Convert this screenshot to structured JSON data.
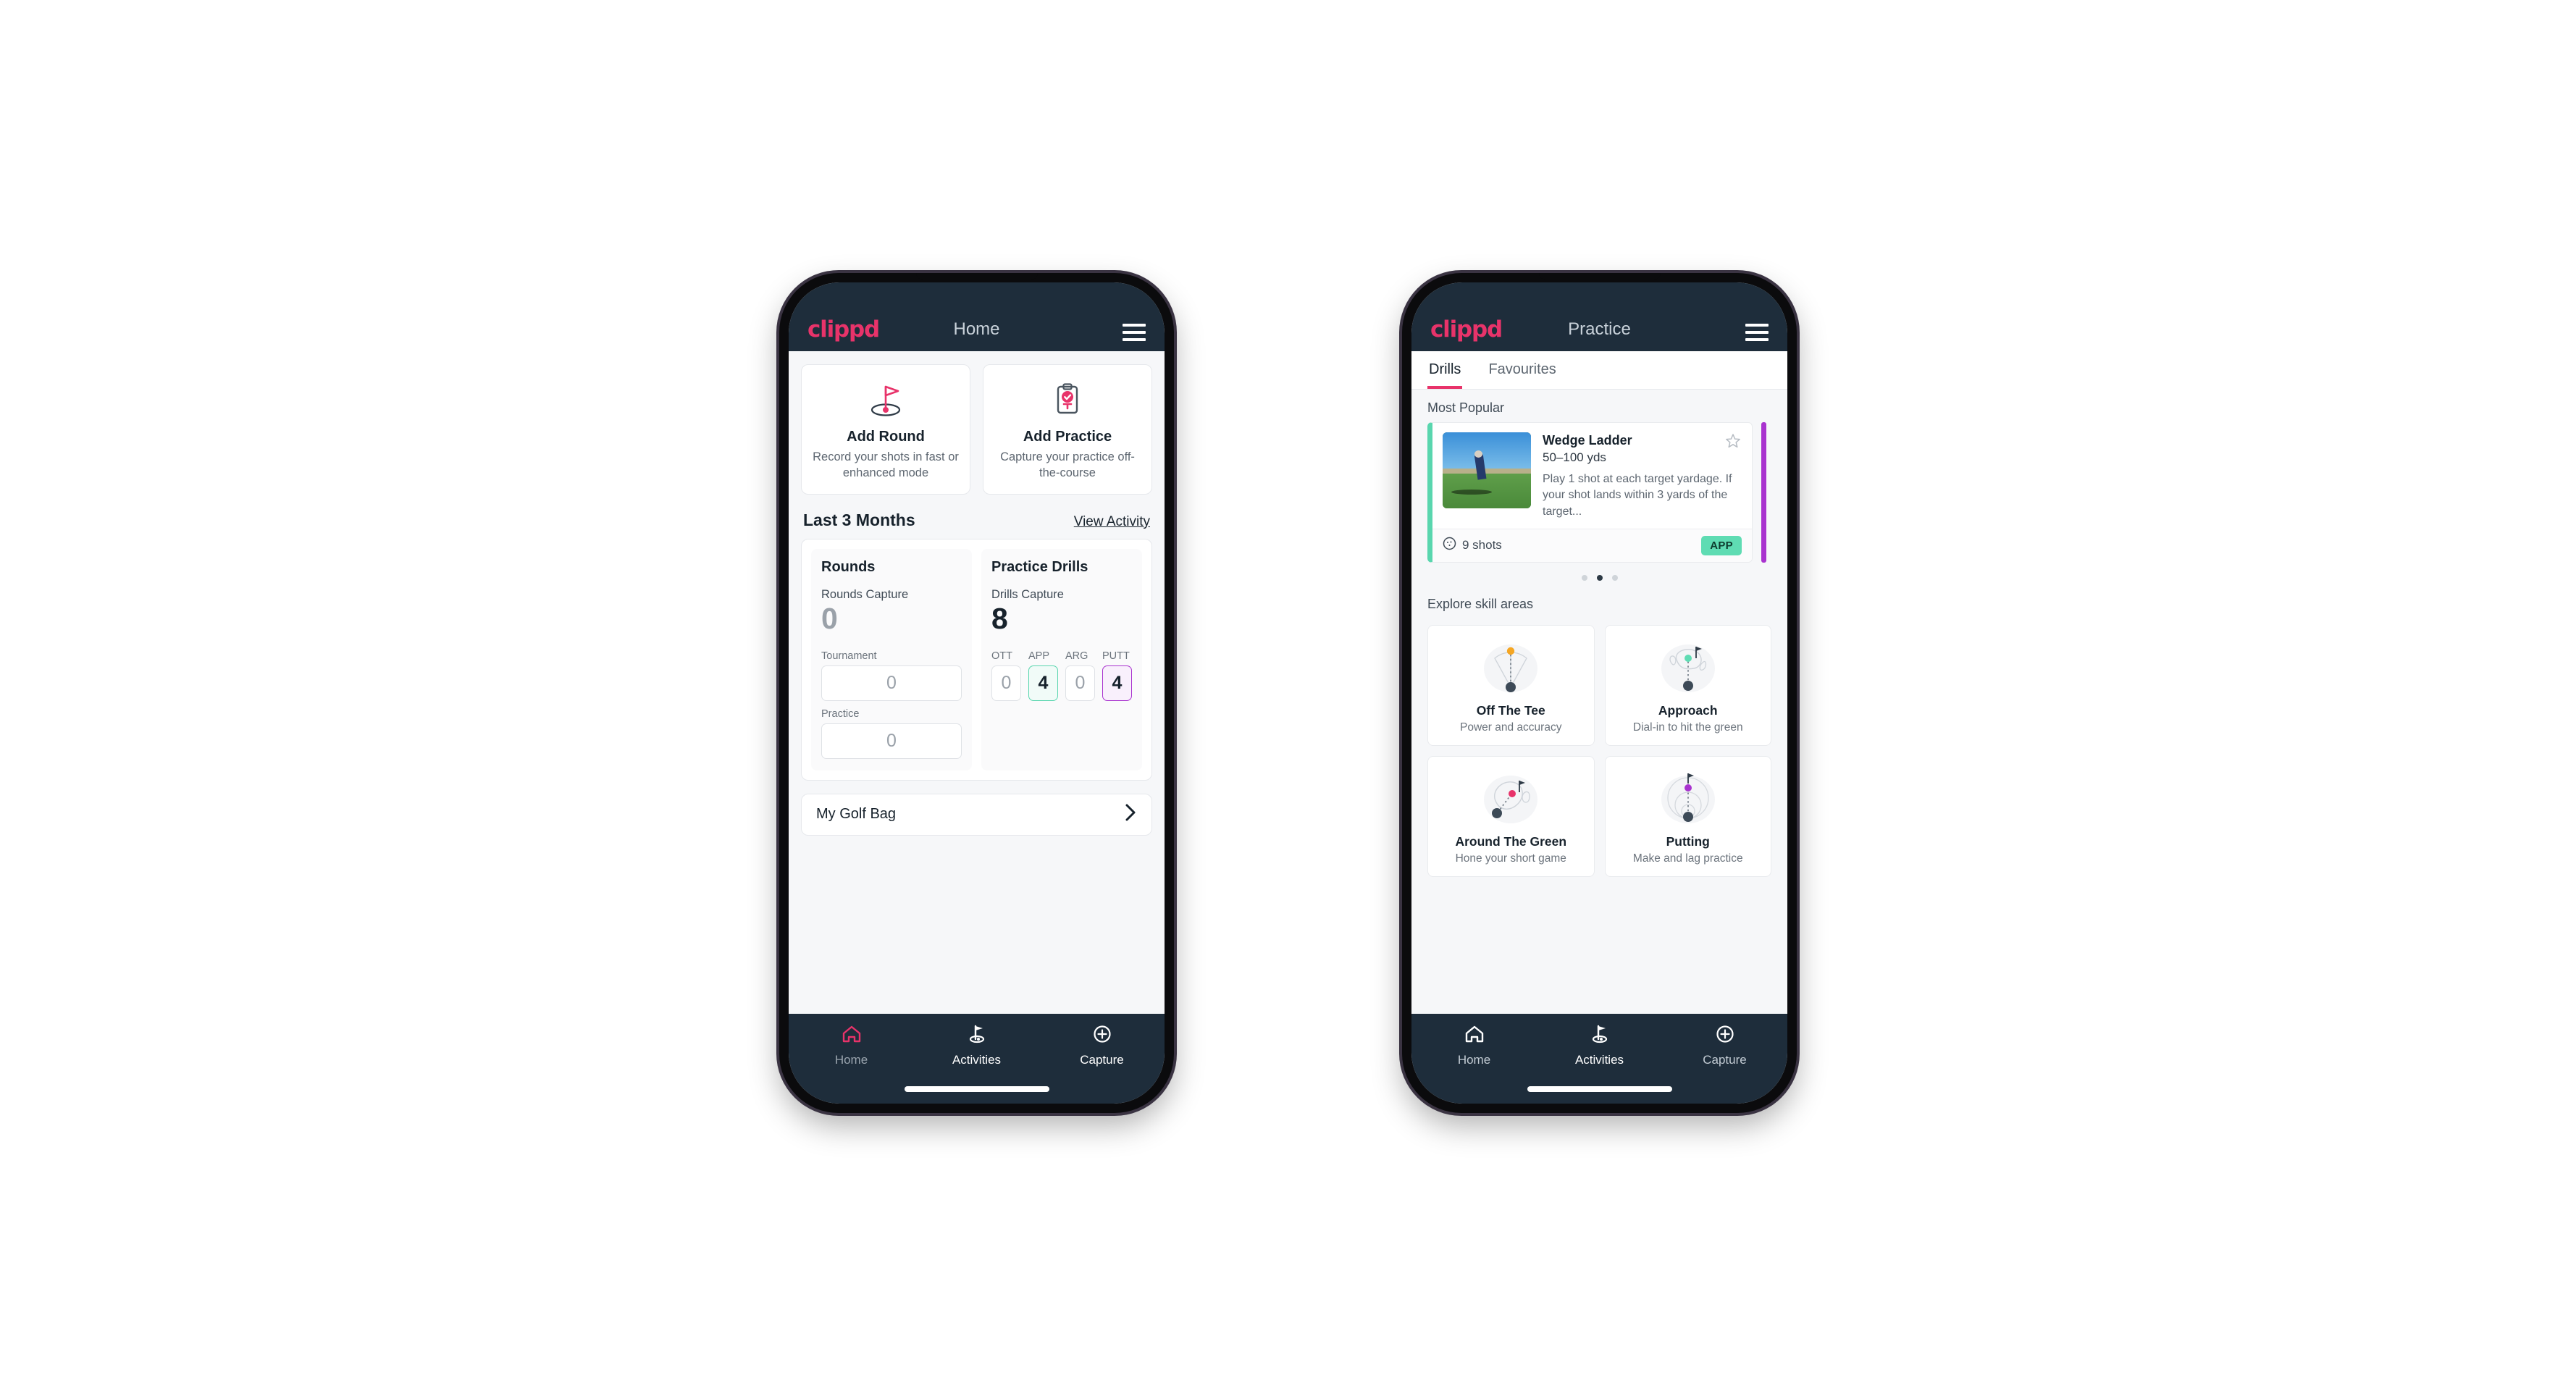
{
  "brand": {
    "logo_text": "clippd",
    "accent_pink": "#e8336a",
    "dark_navy": "#1e2d3b",
    "green": "#5fdcb3",
    "purple": "#a933cf"
  },
  "phone_home": {
    "appbar": {
      "title": "Home",
      "logo": "clippd",
      "menu_icon": "hamburger-icon"
    },
    "quick_actions": [
      {
        "icon": "golf-flag-hole-icon",
        "title": "Add Round",
        "subtitle": "Record your shots in fast or enhanced mode"
      },
      {
        "icon": "clipboard-check-icon",
        "title": "Add Practice",
        "subtitle": "Capture your practice off-the-course"
      }
    ],
    "section": {
      "title": "Last 3 Months",
      "link": "View Activity"
    },
    "stats": [
      {
        "heading": "Rounds",
        "capture_label": "Rounds Capture",
        "capture_value": "0",
        "capture_state": "zero",
        "metrics": [
          {
            "label": "Tournament",
            "value": "0",
            "state": "plain",
            "full": true
          },
          {
            "label": "Practice",
            "value": "0",
            "state": "plain",
            "full": true
          }
        ]
      },
      {
        "heading": "Practice Drills",
        "capture_label": "Drills Capture",
        "capture_value": "8",
        "capture_state": "filled",
        "metrics": [
          {
            "label": "OTT",
            "value": "0",
            "state": "plain",
            "full": false
          },
          {
            "label": "APP",
            "value": "4",
            "state": "app",
            "full": false
          },
          {
            "label": "ARG",
            "value": "0",
            "state": "plain",
            "full": false
          },
          {
            "label": "PUTT",
            "value": "4",
            "state": "putt",
            "full": false
          }
        ]
      }
    ],
    "golf_bag": {
      "label": "My Golf Bag",
      "chevron_icon": "chevron-right-icon"
    },
    "bottom_nav": [
      {
        "icon": "home-icon",
        "label": "Home",
        "active": true
      },
      {
        "icon": "golf-flag-icon",
        "label": "Activities",
        "active": false
      },
      {
        "icon": "plus-circle-icon",
        "label": "Capture",
        "active": false
      }
    ]
  },
  "phone_practice": {
    "appbar": {
      "title": "Practice",
      "logo": "clippd",
      "menu_icon": "hamburger-icon"
    },
    "tabs": [
      {
        "label": "Drills",
        "active": true
      },
      {
        "label": "Favourites",
        "active": false
      }
    ],
    "most_popular_label": "Most Popular",
    "drill": {
      "title": "Wedge Ladder",
      "range": "50–100 yds",
      "description": "Play 1 shot at each target yardage. If your shot lands within 3 yards of the target...",
      "shots": "9 shots",
      "shots_icon": "golf-ball-icon",
      "badge": "APP",
      "star_icon": "star-outline-icon",
      "accent_left": "#5fdcb3",
      "accent_peek": "#a933cf"
    },
    "carousel_dots": [
      false,
      true,
      false
    ],
    "explore_label": "Explore skill areas",
    "skills": [
      {
        "icon": "tee-fan-icon",
        "name": "Off The Tee",
        "desc": "Power and accuracy",
        "dot_color": "#f5a623"
      },
      {
        "icon": "green-target-icon",
        "name": "Approach",
        "desc": "Dial-in to hit the green",
        "dot_color": "#5fdcb3"
      },
      {
        "icon": "chip-green-icon",
        "name": "Around The Green",
        "desc": "Hone your short game",
        "dot_color": "#e8336a"
      },
      {
        "icon": "putt-rings-icon",
        "name": "Putting",
        "desc": "Make and lag practice",
        "dot_color": "#a933cf"
      }
    ],
    "bottom_nav": [
      {
        "icon": "home-icon",
        "label": "Home",
        "active": false
      },
      {
        "icon": "golf-flag-icon",
        "label": "Activities",
        "active": true
      },
      {
        "icon": "plus-circle-icon",
        "label": "Capture",
        "active": false
      }
    ]
  }
}
